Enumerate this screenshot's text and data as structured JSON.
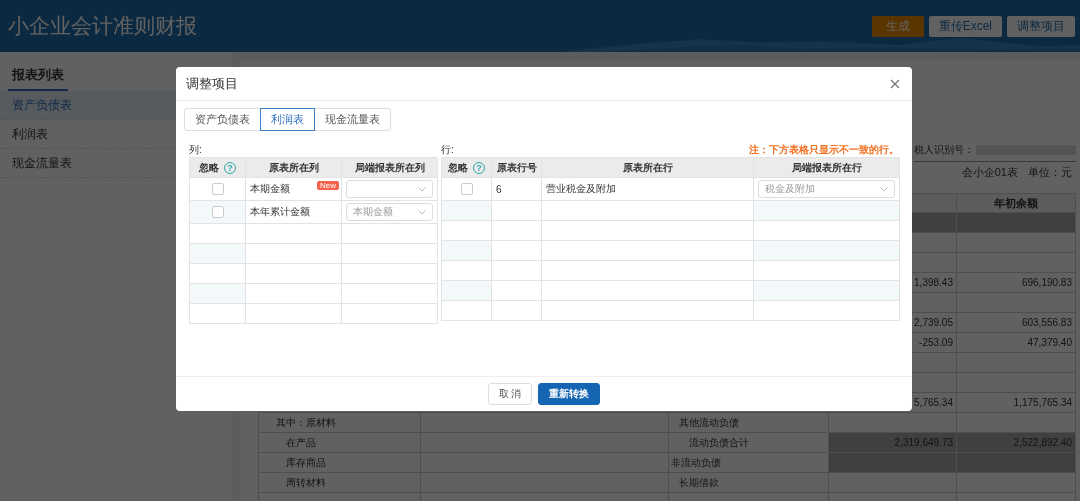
{
  "header": {
    "title": "小企业会计准则财报",
    "buttons": [
      {
        "label": "生成",
        "kind": "primary"
      },
      {
        "label": "重传Excel",
        "kind": "default"
      },
      {
        "label": "调整项目",
        "kind": "default"
      }
    ]
  },
  "sidebar": {
    "title": "报表列表",
    "items": [
      {
        "label": "资产负债表",
        "selected": true
      },
      {
        "label": "利润表",
        "selected": false
      },
      {
        "label": "现金流量表",
        "selected": false
      }
    ]
  },
  "report": {
    "taxpayer_label": "税人识别号：",
    "form_code": "会小企01表",
    "unit": "单位：元",
    "table": {
      "header_row": {
        "column_5": "年初余额"
      },
      "rows": [
        {
          "shaded": true
        },
        {
          "shaded": false
        },
        {
          "shaded": false
        },
        {
          "shaded": false,
          "column_4": "1,398.43",
          "column_5": "696,190.83"
        },
        {
          "shaded": false
        },
        {
          "shaded": false,
          "column_4": "2,739.05",
          "column_5": "603,556.83"
        },
        {
          "shaded": false,
          "column_4": "-253.09",
          "column_5": "47,379.40"
        },
        {
          "shaded": false
        },
        {
          "shaded": false
        },
        {
          "shaded": false,
          "column_4": "5,765.34",
          "column_5": "1,175,765.34"
        },
        {
          "shaded": false,
          "column_1": {
            "text": "其中：原材料",
            "kind": "item"
          },
          "column_3": {
            "text": "其他流动负债",
            "kind": "item"
          }
        },
        {
          "shaded": true,
          "column_1": {
            "text": "在产品",
            "kind": "sub"
          },
          "column_3": {
            "text": "流动负债合计",
            "kind": "sub"
          },
          "column_4": "2,319,649.73",
          "column_5": "2,522,892.40"
        },
        {
          "shaded": true,
          "column_1": {
            "text": "库存商品",
            "kind": "sub"
          },
          "column_3": {
            "text": "非流动负债",
            "kind": "head"
          }
        },
        {
          "shaded": false,
          "column_1": {
            "text": "周转材料",
            "kind": "sub"
          },
          "column_3": {
            "text": "长期借款",
            "kind": "item"
          }
        },
        {
          "shaded": false
        }
      ]
    }
  },
  "dialog": {
    "title": "调整项目",
    "tabs": [
      {
        "label": "资产负债表",
        "selected": false
      },
      {
        "label": "利润表",
        "selected": true
      },
      {
        "label": "现金流量表",
        "selected": false
      }
    ],
    "columns_section": {
      "label": "列:",
      "help_icon": "?",
      "headers": [
        "忽略",
        "原表所在列",
        "局端报表所在列"
      ],
      "rows": [
        {
          "kind": "mapping",
          "ignored": false,
          "source": "本期金额",
          "badge": "New"
        },
        {
          "kind": "mapping",
          "ignored": false,
          "source": "本年累计金额",
          "target": "本期金额"
        },
        {
          "kind": "empty"
        },
        {
          "kind": "empty"
        },
        {
          "kind": "empty"
        },
        {
          "kind": "empty"
        },
        {
          "kind": "empty"
        }
      ]
    },
    "rows_section": {
      "label": "行:",
      "note": "注：下方表格只显示不一致的行。",
      "help_icon": "?",
      "headers": [
        "忽略",
        "原表行号",
        "原表所在行",
        "局端报表所在行"
      ],
      "rows": [
        {
          "kind": "mapping",
          "ignored": false,
          "line": "6",
          "source": "营业税金及附加",
          "target": "税金及附加"
        },
        {
          "kind": "empty"
        },
        {
          "kind": "empty"
        },
        {
          "kind": "empty"
        },
        {
          "kind": "empty"
        },
        {
          "kind": "empty"
        },
        {
          "kind": "empty"
        }
      ]
    },
    "buttons": [
      {
        "label": "取 消",
        "kind": "default"
      },
      {
        "label": "重新转换",
        "kind": "primary"
      }
    ]
  }
}
